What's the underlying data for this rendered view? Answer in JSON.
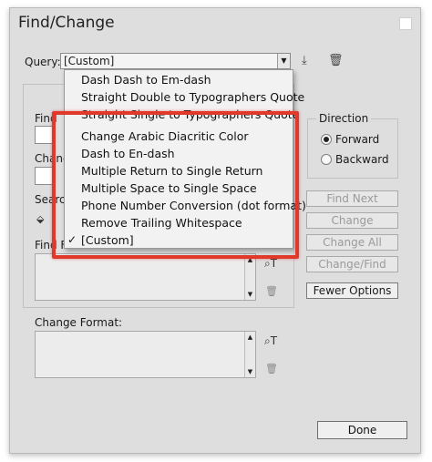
{
  "window": {
    "title": "Find/Change"
  },
  "query": {
    "label": "Query:",
    "selected": "[Custom]",
    "options": [
      "Dash Dash to Em-dash",
      "Straight Double to Typographers Quote",
      "Straight Single to Typographers Quote",
      "Change Arabic Diacritic Color",
      "Dash to En-dash",
      "Multiple Return to Single Return",
      "Multiple Space to Single Space",
      "Phone Number Conversion (dot format)",
      "Remove Trailing Whitespace",
      "[Custom]"
    ],
    "checked_mark": "✓"
  },
  "fields": {
    "find_what_label": "Find",
    "change_to_label": "Chang",
    "search_label": "Searc",
    "find_format_label": "Find F",
    "change_format_label": "Change Format:"
  },
  "direction": {
    "title": "Direction",
    "forward": "Forward",
    "backward": "Backward",
    "selected": "forward"
  },
  "buttons": {
    "find_next": "Find Next",
    "change": "Change",
    "change_all": "Change All",
    "change_find": "Change/Find",
    "fewer_options": "Fewer Options",
    "done": "Done"
  },
  "icons": {
    "save": "save-query-icon",
    "delete": "delete-query-icon",
    "format": "specify-format-icon",
    "clear": "clear-format-icon"
  },
  "colors": {
    "highlight": "#e0392b"
  }
}
